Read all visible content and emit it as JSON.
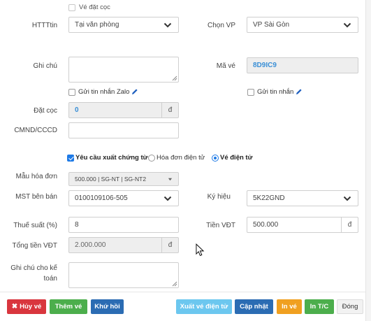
{
  "form": {
    "deposit_ticket": {
      "label": "Vé đặt cọc",
      "checked": false
    },
    "payment_info": {
      "label": "HTTTtin",
      "value": "Tại văn phòng"
    },
    "office": {
      "label": "Chọn VP",
      "value": "VP Sài Gòn"
    },
    "note": {
      "label": "Ghi chú",
      "value": ""
    },
    "ticket_code": {
      "label": "Mã vé",
      "value": "8D9IC9"
    },
    "send_zalo": {
      "label": "Gửi tin nhắn Zalo",
      "checked": false
    },
    "send_sms": {
      "label": "Gửi tin nhắn",
      "checked": false
    },
    "deposit": {
      "label": "Đặt cọc",
      "value": "0",
      "unit": "đ"
    },
    "id_card": {
      "label": "CMND/CCCD",
      "value": ""
    },
    "invoice_request": {
      "label": "Yêu cầu xuất chứng từ",
      "checked": true
    },
    "invoice_types": [
      {
        "label": "Hóa đơn điện tử",
        "selected": false
      },
      {
        "label": "Vé điện tử",
        "selected": true
      }
    ],
    "invoice_template": {
      "label": "Mẫu hóa đơn",
      "value": "500.000 | SG-NT | SG-NT2"
    },
    "seller_tax_code": {
      "label": "MST bên bán",
      "value": "0100109106-505"
    },
    "symbol": {
      "label": "Ký hiệu",
      "value": "5K22GND"
    },
    "tax_rate": {
      "label": "Thuế suất (%)",
      "value": "8"
    },
    "ticket_amount": {
      "label": "Tiền VĐT",
      "value": "500.000",
      "unit": "đ"
    },
    "total_amount": {
      "label": "Tổng tiền VĐT",
      "value": "2.000.000",
      "unit": "đ"
    },
    "accountant_note": {
      "label_line1": "Ghi chú cho kế",
      "label_line2": "toán",
      "value": ""
    }
  },
  "buttons": {
    "cancel": "Hủy vé",
    "add": "Thêm vé",
    "rescue": "Khứ hồi",
    "export_eticket": "Xuất vé điện tử",
    "update": "Cập nhật",
    "print": "In vé",
    "print_tc": "In T/C",
    "close": "Đóng"
  },
  "colors": {
    "cancel": "#d9363e",
    "add": "#4cae4c",
    "rescue": "#2b6cb3",
    "export_eticket": "#6cc7ef",
    "update": "#2b6cb3",
    "print": "#f0a020",
    "print_tc": "#4cae4c",
    "close": "#f2f2f2",
    "accent_blue": "#3a8fd6"
  }
}
